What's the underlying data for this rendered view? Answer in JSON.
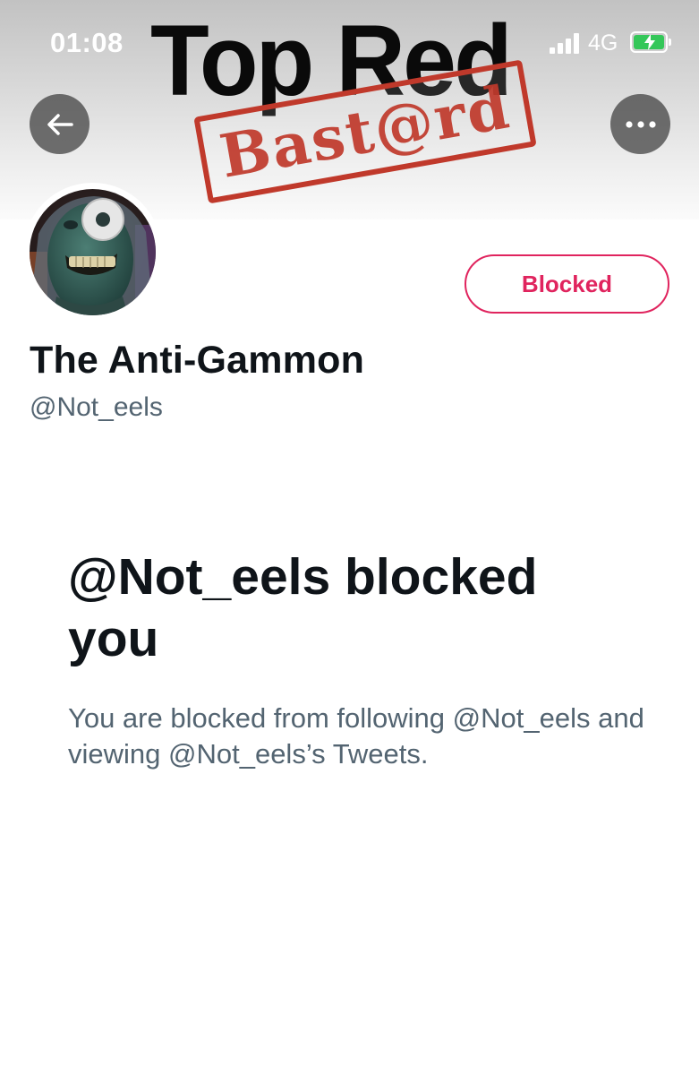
{
  "status_bar": {
    "time": "01:08",
    "network": "4G",
    "signal_icon": "cellular-signal-icon",
    "battery_icon": "battery-charging-icon",
    "battery_color": "#34c759"
  },
  "banner": {
    "title": "Top Red",
    "stamp_text": "Bast@rd",
    "stamp_color": "#c0392b"
  },
  "header": {
    "back_icon": "arrow-left-icon",
    "more_icon": "ellipsis-icon"
  },
  "profile": {
    "display_name": "The Anti-Gammon",
    "handle": "@Not_eels",
    "blocked_label": "Blocked",
    "accent_color": "#e0245e"
  },
  "notice": {
    "heading": "@Not_eels blocked you",
    "description": "You are blocked from following @Not_eels and viewing @Not_eels’s Tweets."
  }
}
